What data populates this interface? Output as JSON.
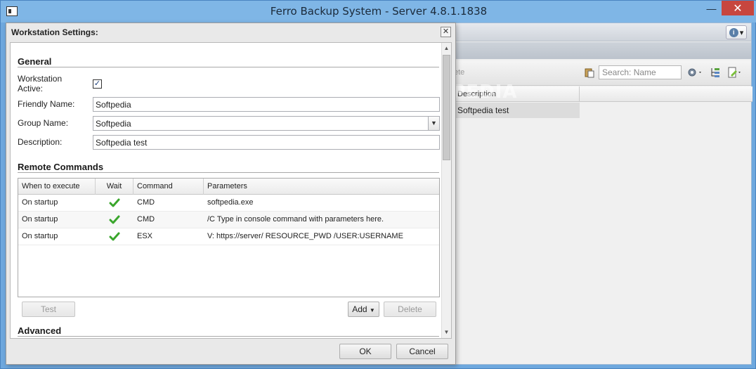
{
  "window": {
    "title": "Ferro Backup System - Server 4.8.1.1838",
    "minimize_label": "—",
    "close_label": "✕"
  },
  "background": {
    "ghost_toolbar_text": "ete",
    "search_placeholder": "Search: Name",
    "grid_header": "Description",
    "grid_row": "Softpedia test",
    "info_caret": "▾"
  },
  "dialog": {
    "title": "Workstation Settings:",
    "close_label": "✕",
    "general": {
      "title": "General",
      "active_label": "Workstation Active:",
      "active_checked": "✓",
      "friendly_label": "Friendly Name:",
      "friendly_value": "Softpedia",
      "group_label": "Group Name:",
      "group_value": "Softpedia",
      "description_label": "Description:",
      "description_value": "Softpedia test"
    },
    "remote_commands": {
      "title": "Remote Commands",
      "columns": [
        "When to execute",
        "Wait",
        "Command",
        "Parameters"
      ],
      "rows": [
        {
          "when": "On startup",
          "wait": true,
          "command": "CMD",
          "params": "softpedia.exe"
        },
        {
          "when": "On startup",
          "wait": true,
          "command": "CMD",
          "params": "/C Type in console command with parameters here."
        },
        {
          "when": "On startup",
          "wait": true,
          "command": "ESX",
          "params": "V: https://server/ RESOURCE_PWD /USER:USERNAME"
        }
      ],
      "test_label": "Test",
      "add_label": "Add",
      "delete_label": "Delete"
    },
    "advanced": {
      "title": "Advanced"
    },
    "ok_label": "OK",
    "cancel_label": "Cancel"
  },
  "watermark": "SOFTPEDIA",
  "colors": {
    "titlebar": "#7fb6e6",
    "close_button": "#c7463f",
    "check_green": "#3aa62c"
  }
}
